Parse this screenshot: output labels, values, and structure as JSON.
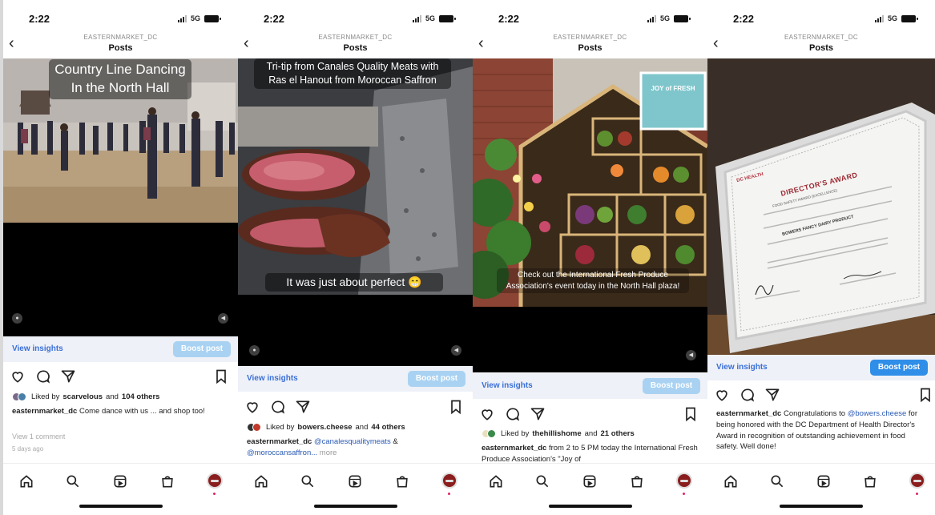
{
  "status_bar": {
    "time": "2:22",
    "network": "5G"
  },
  "header": {
    "account": "EASTERNMARKET_DC",
    "title": "Posts"
  },
  "colors": {
    "link": "#2b5bb5",
    "boost_disabled": "#a9d2f2",
    "boost_active": "#2f8ee8",
    "insights_bg": "#eef1f7",
    "profile_avatar": "#8a1d1d"
  },
  "icons": [
    "back-chevron-icon",
    "heart-icon",
    "comment-icon",
    "share-icon",
    "bookmark-icon",
    "home-icon",
    "search-icon",
    "reels-icon",
    "shop-icon",
    "profile-avatar"
  ],
  "posts": [
    {
      "overlay": [
        "Country Line Dancing",
        "In the North Hall"
      ],
      "insights": "View insights",
      "boost": "Boost post",
      "likes_by": "scarvelous",
      "likes_others": "104 others",
      "username": "easternmarket_dc",
      "caption": "Come dance with us ... and shop too!",
      "comments": "View 1 comment",
      "time_ago": "5 days ago"
    },
    {
      "overlay": [
        "Tri-tip from Canales Quality Meats with",
        "Ras el Hanout from Moroccan Saffron"
      ],
      "overlay2": "It was just about perfect 😁",
      "insights": "View insights",
      "boost": "Boost post",
      "likes_by": "bowers.cheese",
      "likes_others": "44 others",
      "username": "easternmarket_dc",
      "mention1": "@canalesqualitymeats",
      "amp": "&",
      "mention2": "@moroccansaffron...",
      "more": "more"
    },
    {
      "overlay": [
        "Check out the International Fresh Produce",
        "Association's event today in the North Hall plaza!"
      ],
      "sign": "JOY of FRESH",
      "insights": "View insights",
      "boost": "Boost post",
      "likes_by": "thehillishome",
      "likes_others": "21 others",
      "username": "easternmarket_dc",
      "caption": "from 2 to 5 PM today the International Fresh Produce Association's \"Joy of"
    },
    {
      "cert_org": "DC HEALTH",
      "cert_title": "DIRECTOR'S AWARD",
      "cert_sub": "FOOD SAFETY AWARD (EXCELLENCE)",
      "cert_name": "BOWERS FANCY DAIRY PRODUCT",
      "insights": "View insights",
      "boost": "Boost post",
      "username": "easternmarket_dc",
      "caption_pre": "Congratulations to",
      "mention": "@bowers.cheese",
      "caption_post": "for being honored with the DC Department of Health Director's Award in recognition of outstanding achievement in food safety. Well done!"
    }
  ]
}
